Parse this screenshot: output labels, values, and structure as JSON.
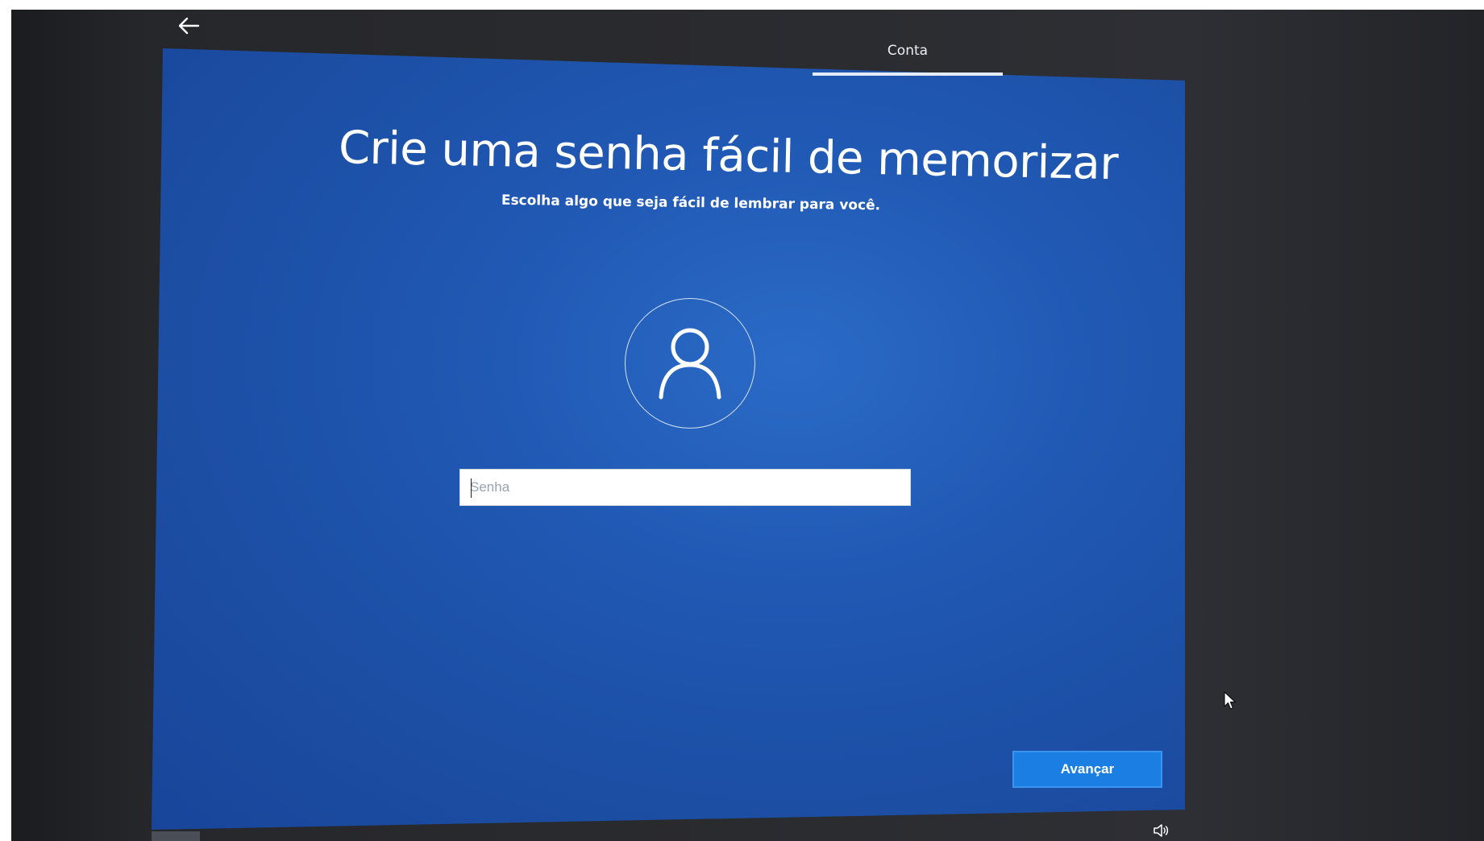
{
  "header": {
    "back_icon": "arrow-left-icon",
    "tabs": [
      {
        "label": "Conta",
        "active": true
      }
    ]
  },
  "main": {
    "title": "Crie uma senha fácil de memorizar",
    "subtitle": "Escolha algo que seja fácil de lembrar para você.",
    "avatar_icon": "user-icon",
    "password": {
      "value": "",
      "placeholder": "Senha"
    }
  },
  "footer": {
    "next_label": "Avançar",
    "volume_icon": "volume-icon"
  },
  "colors": {
    "background_blue": "#1f56ad",
    "button_blue": "#1a7ee3",
    "text": "#ffffff"
  }
}
